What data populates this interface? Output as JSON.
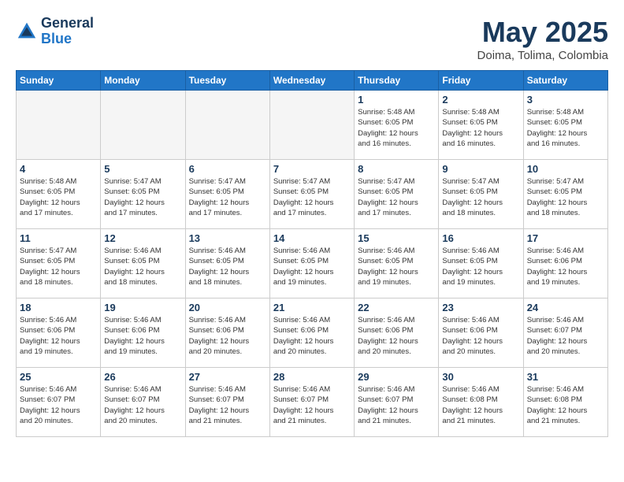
{
  "header": {
    "logo_general": "General",
    "logo_blue": "Blue",
    "month_title": "May 2025",
    "location": "Doima, Tolima, Colombia"
  },
  "weekdays": [
    "Sunday",
    "Monday",
    "Tuesday",
    "Wednesday",
    "Thursday",
    "Friday",
    "Saturday"
  ],
  "weeks": [
    [
      {
        "day": "",
        "info": "",
        "empty": true
      },
      {
        "day": "",
        "info": "",
        "empty": true
      },
      {
        "day": "",
        "info": "",
        "empty": true
      },
      {
        "day": "",
        "info": "",
        "empty": true
      },
      {
        "day": "1",
        "info": "Sunrise: 5:48 AM\nSunset: 6:05 PM\nDaylight: 12 hours\nand 16 minutes.",
        "empty": false
      },
      {
        "day": "2",
        "info": "Sunrise: 5:48 AM\nSunset: 6:05 PM\nDaylight: 12 hours\nand 16 minutes.",
        "empty": false
      },
      {
        "day": "3",
        "info": "Sunrise: 5:48 AM\nSunset: 6:05 PM\nDaylight: 12 hours\nand 16 minutes.",
        "empty": false
      }
    ],
    [
      {
        "day": "4",
        "info": "Sunrise: 5:48 AM\nSunset: 6:05 PM\nDaylight: 12 hours\nand 17 minutes.",
        "empty": false
      },
      {
        "day": "5",
        "info": "Sunrise: 5:47 AM\nSunset: 6:05 PM\nDaylight: 12 hours\nand 17 minutes.",
        "empty": false
      },
      {
        "day": "6",
        "info": "Sunrise: 5:47 AM\nSunset: 6:05 PM\nDaylight: 12 hours\nand 17 minutes.",
        "empty": false
      },
      {
        "day": "7",
        "info": "Sunrise: 5:47 AM\nSunset: 6:05 PM\nDaylight: 12 hours\nand 17 minutes.",
        "empty": false
      },
      {
        "day": "8",
        "info": "Sunrise: 5:47 AM\nSunset: 6:05 PM\nDaylight: 12 hours\nand 17 minutes.",
        "empty": false
      },
      {
        "day": "9",
        "info": "Sunrise: 5:47 AM\nSunset: 6:05 PM\nDaylight: 12 hours\nand 18 minutes.",
        "empty": false
      },
      {
        "day": "10",
        "info": "Sunrise: 5:47 AM\nSunset: 6:05 PM\nDaylight: 12 hours\nand 18 minutes.",
        "empty": false
      }
    ],
    [
      {
        "day": "11",
        "info": "Sunrise: 5:47 AM\nSunset: 6:05 PM\nDaylight: 12 hours\nand 18 minutes.",
        "empty": false
      },
      {
        "day": "12",
        "info": "Sunrise: 5:46 AM\nSunset: 6:05 PM\nDaylight: 12 hours\nand 18 minutes.",
        "empty": false
      },
      {
        "day": "13",
        "info": "Sunrise: 5:46 AM\nSunset: 6:05 PM\nDaylight: 12 hours\nand 18 minutes.",
        "empty": false
      },
      {
        "day": "14",
        "info": "Sunrise: 5:46 AM\nSunset: 6:05 PM\nDaylight: 12 hours\nand 19 minutes.",
        "empty": false
      },
      {
        "day": "15",
        "info": "Sunrise: 5:46 AM\nSunset: 6:05 PM\nDaylight: 12 hours\nand 19 minutes.",
        "empty": false
      },
      {
        "day": "16",
        "info": "Sunrise: 5:46 AM\nSunset: 6:05 PM\nDaylight: 12 hours\nand 19 minutes.",
        "empty": false
      },
      {
        "day": "17",
        "info": "Sunrise: 5:46 AM\nSunset: 6:06 PM\nDaylight: 12 hours\nand 19 minutes.",
        "empty": false
      }
    ],
    [
      {
        "day": "18",
        "info": "Sunrise: 5:46 AM\nSunset: 6:06 PM\nDaylight: 12 hours\nand 19 minutes.",
        "empty": false
      },
      {
        "day": "19",
        "info": "Sunrise: 5:46 AM\nSunset: 6:06 PM\nDaylight: 12 hours\nand 19 minutes.",
        "empty": false
      },
      {
        "day": "20",
        "info": "Sunrise: 5:46 AM\nSunset: 6:06 PM\nDaylight: 12 hours\nand 20 minutes.",
        "empty": false
      },
      {
        "day": "21",
        "info": "Sunrise: 5:46 AM\nSunset: 6:06 PM\nDaylight: 12 hours\nand 20 minutes.",
        "empty": false
      },
      {
        "day": "22",
        "info": "Sunrise: 5:46 AM\nSunset: 6:06 PM\nDaylight: 12 hours\nand 20 minutes.",
        "empty": false
      },
      {
        "day": "23",
        "info": "Sunrise: 5:46 AM\nSunset: 6:06 PM\nDaylight: 12 hours\nand 20 minutes.",
        "empty": false
      },
      {
        "day": "24",
        "info": "Sunrise: 5:46 AM\nSunset: 6:07 PM\nDaylight: 12 hours\nand 20 minutes.",
        "empty": false
      }
    ],
    [
      {
        "day": "25",
        "info": "Sunrise: 5:46 AM\nSunset: 6:07 PM\nDaylight: 12 hours\nand 20 minutes.",
        "empty": false
      },
      {
        "day": "26",
        "info": "Sunrise: 5:46 AM\nSunset: 6:07 PM\nDaylight: 12 hours\nand 20 minutes.",
        "empty": false
      },
      {
        "day": "27",
        "info": "Sunrise: 5:46 AM\nSunset: 6:07 PM\nDaylight: 12 hours\nand 21 minutes.",
        "empty": false
      },
      {
        "day": "28",
        "info": "Sunrise: 5:46 AM\nSunset: 6:07 PM\nDaylight: 12 hours\nand 21 minutes.",
        "empty": false
      },
      {
        "day": "29",
        "info": "Sunrise: 5:46 AM\nSunset: 6:07 PM\nDaylight: 12 hours\nand 21 minutes.",
        "empty": false
      },
      {
        "day": "30",
        "info": "Sunrise: 5:46 AM\nSunset: 6:08 PM\nDaylight: 12 hours\nand 21 minutes.",
        "empty": false
      },
      {
        "day": "31",
        "info": "Sunrise: 5:46 AM\nSunset: 6:08 PM\nDaylight: 12 hours\nand 21 minutes.",
        "empty": false
      }
    ]
  ]
}
